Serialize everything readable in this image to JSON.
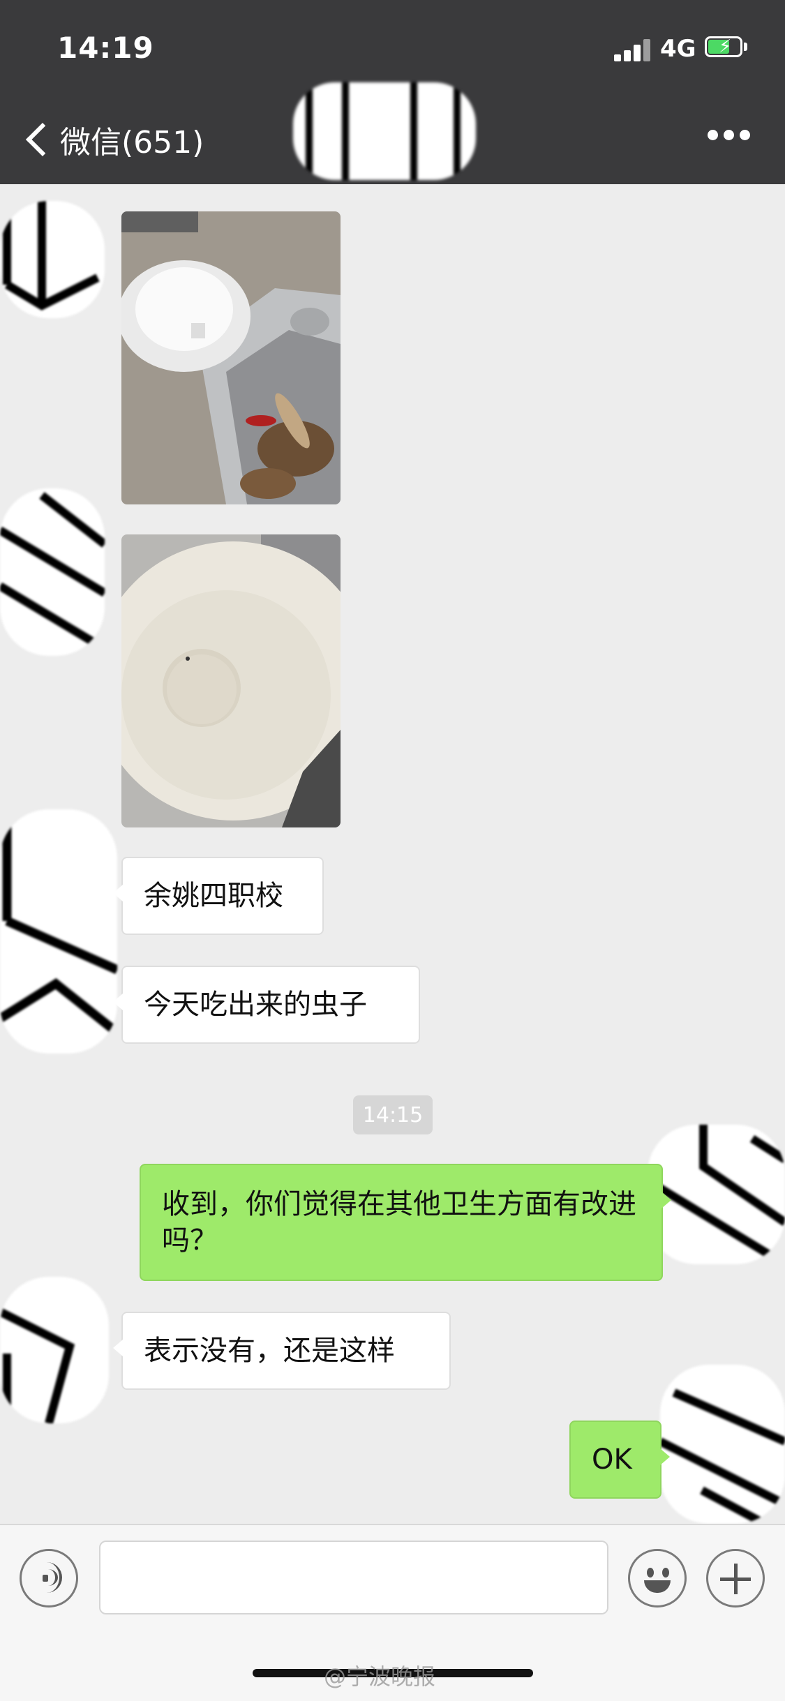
{
  "status_bar": {
    "time": "14:19",
    "network": "4G"
  },
  "nav": {
    "back_label": "微信(651)"
  },
  "messages": [
    {
      "side": "received",
      "type": "image",
      "content": "photo-food-tray-with-bug"
    },
    {
      "side": "received",
      "type": "image",
      "content": "photo-white-bowl"
    },
    {
      "side": "received",
      "type": "text",
      "text": "余姚四职校"
    },
    {
      "side": "received",
      "type": "text",
      "text": "今天吃出来的虫子"
    },
    {
      "side": "system",
      "type": "timestamp",
      "text": "14:15"
    },
    {
      "side": "sent",
      "type": "text",
      "text": "收到，你们觉得在其他卫生方面有改进吗？"
    },
    {
      "side": "received",
      "type": "text",
      "text": "表示没有，还是这样"
    },
    {
      "side": "sent",
      "type": "text",
      "text": "OK"
    }
  ],
  "input_bar": {
    "icons": [
      "voice-icon",
      "emoji-icon",
      "plus-icon"
    ]
  },
  "watermark": "@宁波晚报",
  "colors": {
    "nav_bg": "#3a3a3c",
    "chat_bg": "#ededed",
    "sent_bubble": "#9eea6a",
    "received_bubble": "#ffffff"
  }
}
